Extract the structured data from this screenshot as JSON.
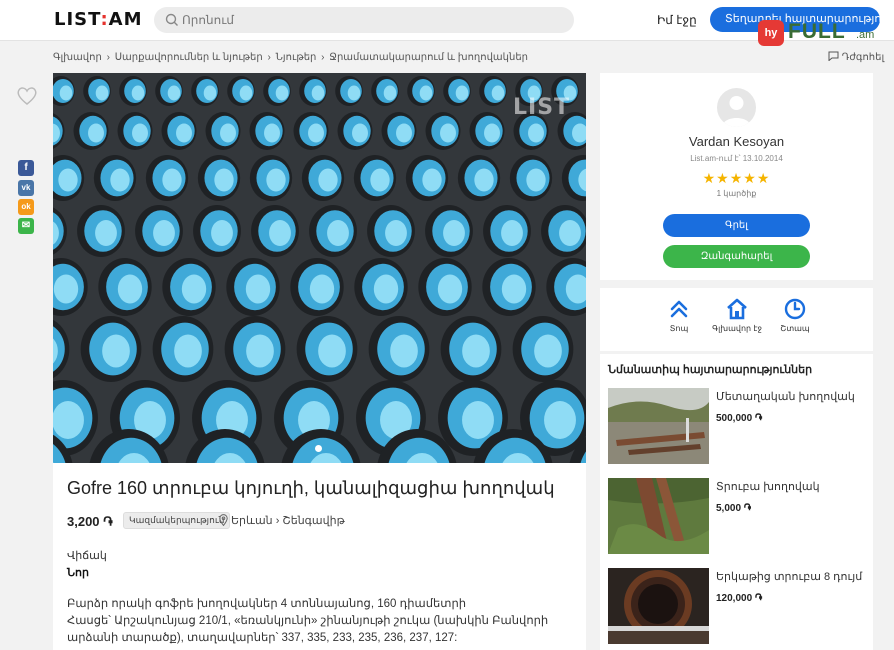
{
  "header": {
    "logo": "LIST",
    "logo_dot": ":",
    "logo_end": "AM",
    "search_placeholder": "Որոնում",
    "my_page": "Իմ էջը",
    "post_button": "Տեղադրել հայտարարություն"
  },
  "watermark": {
    "badge": "hy",
    "text": "FULL",
    "suffix": ".am"
  },
  "breadcrumb": [
    "Գլխավոր",
    "Սարքավորումներ և նյութեր",
    "Նյութեր",
    "Ջրամատակարարում և խողովակներ"
  ],
  "report_label": "Դժգոհել",
  "share": {
    "facebook": "f",
    "vk": "vk",
    "ok": "ok",
    "email": "✉"
  },
  "listing": {
    "photo_watermark": "LIST",
    "title": "Gofre 160 տրուբա կոյուղի, կանալիզացիա խողովակ",
    "price": "3,200 ֏",
    "badge": "Կազմակերպություն",
    "location": "Երևան › Շենգավիթ",
    "condition_label": "Վիճակ",
    "condition_value": "Նոր",
    "description": "Բարձր որակի գոֆրե խողովակներ 4 տոննայանոց, 160 դիամետրի\nՀասցե՝ Արշակունյաց 210/1, «եռանկյունի» շինանյութի շուկա (նախկին Բանվորի արձանի տարածք), տաղավարներ՝ 337, 335, 233, 235, 236, 237, 127:"
  },
  "seller": {
    "name": "Vardan Kesoyan",
    "since": "List.am-ում է՝ 13.10.2014",
    "rating": 5,
    "stars": "★★★★★",
    "reviews": "1 կարծիք",
    "message_button": "Գրել",
    "call_button": "Զանգահարել"
  },
  "actions": [
    {
      "label": "Տոպ",
      "icon": "double-chevron-up-icon"
    },
    {
      "label": "Գլխավոր էջ",
      "icon": "home-icon"
    },
    {
      "label": "Շտապ",
      "icon": "clock-icon"
    }
  ],
  "similar": {
    "heading": "Նմանատիպ հայտարարություններ",
    "items": [
      {
        "title": "Մետաղական խողովակ",
        "price": "500,000 ֏"
      },
      {
        "title": "Տրուբա խողովակ",
        "price": "5,000 ֏"
      },
      {
        "title": "Երկաթից տրուբա 8 դույմ",
        "price": "120,000 ֏"
      }
    ]
  },
  "colors": {
    "primary": "#1a6ede",
    "green": "#3cb54a",
    "star": "#f5b400",
    "logo_accent": "#e5322d"
  }
}
